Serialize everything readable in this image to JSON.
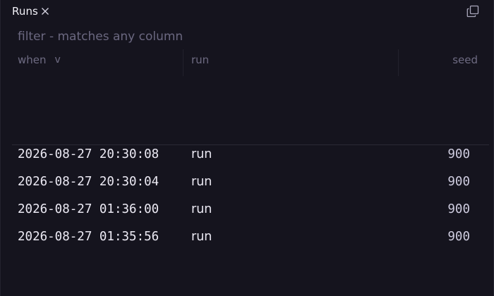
{
  "tab": {
    "label": "Runs"
  },
  "filter": {
    "placeholder": "filter - matches any column",
    "value": ""
  },
  "columns": {
    "when": "when",
    "when_sort": "v",
    "run": "run",
    "seed": "seed"
  },
  "rows": [
    {
      "when": "2026-08-27 20:30:08",
      "run": "run",
      "seed": "900"
    },
    {
      "when": "2026-08-27 20:30:04",
      "run": "run",
      "seed": "900"
    },
    {
      "when": "2026-08-27 01:36:00",
      "run": "run",
      "seed": "900"
    },
    {
      "when": "2026-08-27 01:35:56",
      "run": "run",
      "seed": "900"
    }
  ],
  "icons": {
    "close": "close-icon",
    "popout": "popout-icon"
  }
}
